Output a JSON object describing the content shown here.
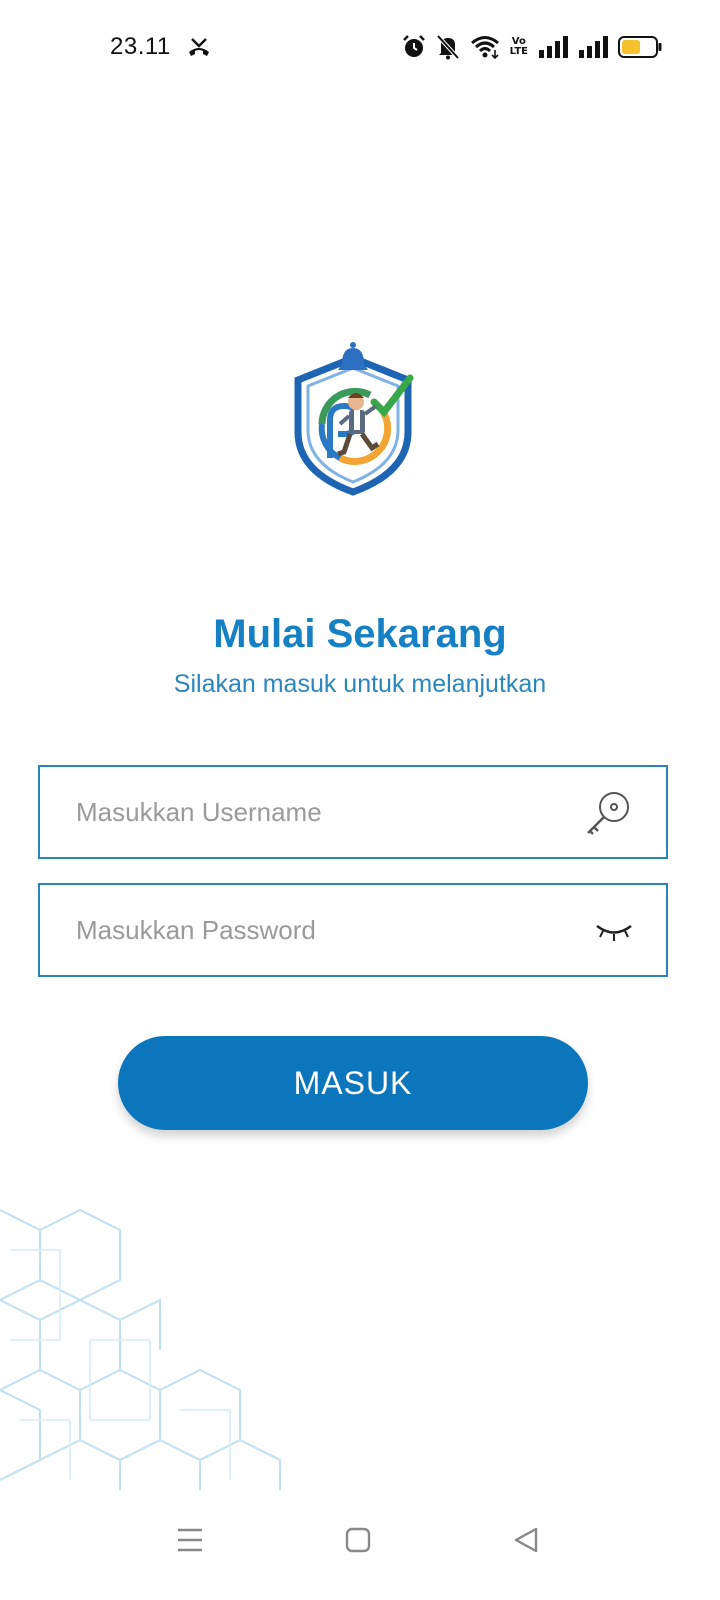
{
  "status_bar": {
    "time": "23.11",
    "icons": [
      "missed-call-icon",
      "alarm-icon",
      "bell-off-icon",
      "wifi-icon",
      "volte-icon",
      "signal-1-icon",
      "signal-2-icon",
      "battery-icon"
    ],
    "volte_line1": "Vo",
    "volte_line2": "LTE",
    "battery_color": "#f5c12e"
  },
  "login": {
    "title": "Mulai Sekarang",
    "subtitle": "Silakan masuk untuk melanjutkan",
    "username_placeholder": "Masukkan Username",
    "username_value": "",
    "password_placeholder": "Masukkan Password",
    "password_value": "",
    "submit_label": "MASUK",
    "username_icon": "key-icon",
    "password_icon": "eye-closed-icon"
  },
  "colors": {
    "accent": "#1580c4",
    "button": "#0b76bc",
    "border": "#2a84b8"
  },
  "nav_bar": {
    "buttons": [
      "menu-icon",
      "home-icon",
      "back-icon"
    ]
  }
}
